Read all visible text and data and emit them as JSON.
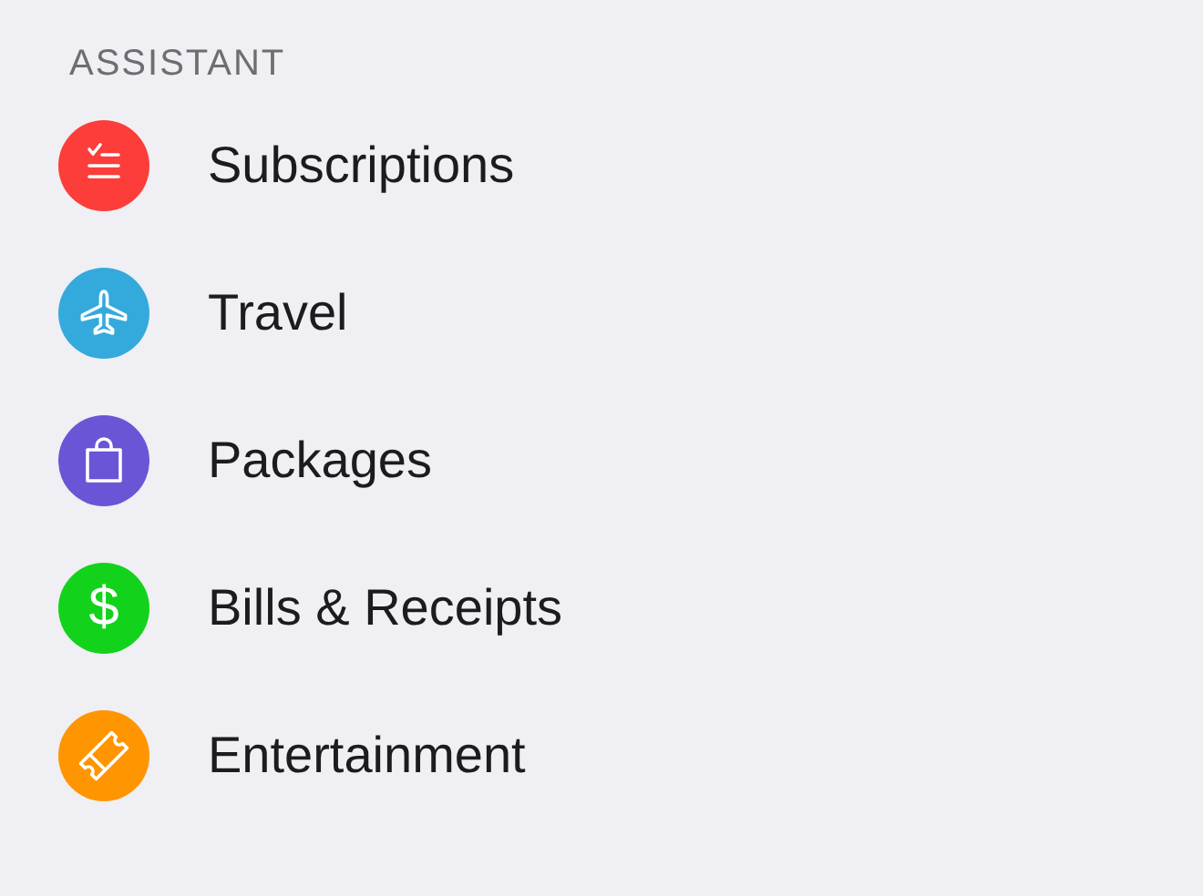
{
  "section": {
    "title": "ASSISTANT"
  },
  "items": [
    {
      "label": "Subscriptions",
      "color": "#fc3d39"
    },
    {
      "label": "Travel",
      "color": "#34aadc"
    },
    {
      "label": "Packages",
      "color": "#6a55d6"
    },
    {
      "label": "Bills & Receipts",
      "color": "#13d21c",
      "glyph": "$"
    },
    {
      "label": "Entertainment",
      "color": "#ff9500"
    }
  ]
}
